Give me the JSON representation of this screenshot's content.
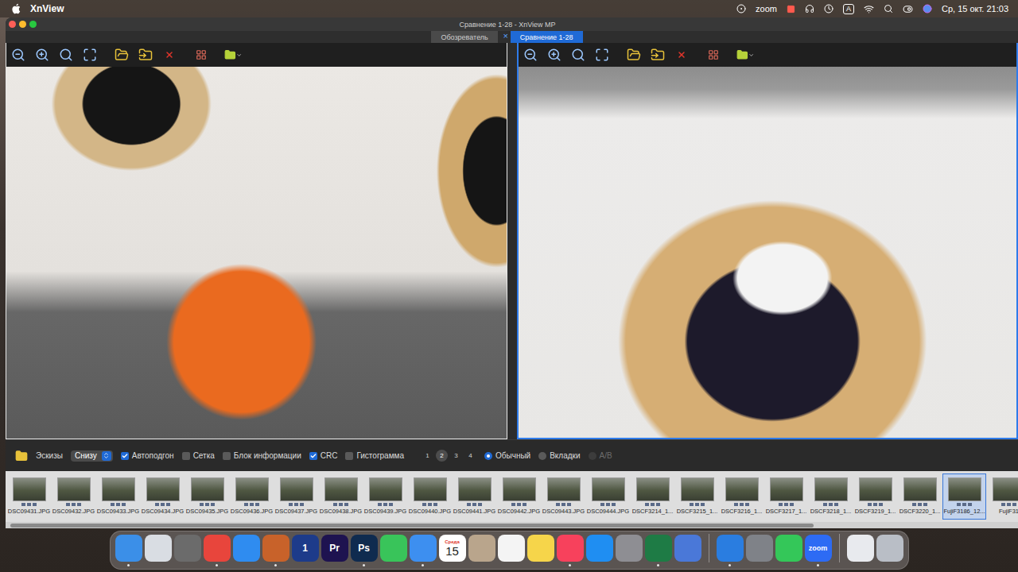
{
  "menubar": {
    "app": "XnView",
    "zoom_label": "zoom",
    "input_source": "A",
    "clock": "Ср, 15 окт. 21:03"
  },
  "window": {
    "title": "Сравнение 1-28 - XnView MP"
  },
  "tabs": [
    {
      "label": "Обозреватель",
      "selected": false
    },
    {
      "label": "Сравнение 1-28",
      "selected": true
    }
  ],
  "tab_close": "×",
  "panes": [
    {
      "focused": false
    },
    {
      "focused": true
    }
  ],
  "options": {
    "thumbs_label": "Эскизы",
    "position": "Снизу",
    "checkboxes": [
      {
        "label": "Автоподгон",
        "checked": true
      },
      {
        "label": "Сетка",
        "checked": false
      },
      {
        "label": "Блок информации",
        "checked": false
      },
      {
        "label": "CRC",
        "checked": true
      },
      {
        "label": "Гистограмма",
        "checked": false
      }
    ],
    "pages": [
      {
        "label": "1",
        "selected": false
      },
      {
        "label": "2",
        "selected": true
      },
      {
        "label": "3",
        "selected": false
      },
      {
        "label": "4",
        "selected": false
      }
    ],
    "modes": [
      {
        "label": "Обычный",
        "selected": true,
        "disabled": false
      },
      {
        "label": "Вкладки",
        "selected": false,
        "disabled": false
      },
      {
        "label": "A/B",
        "selected": false,
        "disabled": true
      }
    ]
  },
  "thumbnails": [
    {
      "label": "DSC09431.JPG",
      "selected": false
    },
    {
      "label": "DSC09432.JPG",
      "selected": false
    },
    {
      "label": "DSC09433.JPG",
      "selected": false
    },
    {
      "label": "DSC09434.JPG",
      "selected": false
    },
    {
      "label": "DSC09435.JPG",
      "selected": false
    },
    {
      "label": "DSC09436.JPG",
      "selected": false
    },
    {
      "label": "DSC09437.JPG",
      "selected": false
    },
    {
      "label": "DSC09438.JPG",
      "selected": false
    },
    {
      "label": "DSC09439.JPG",
      "selected": false
    },
    {
      "label": "DSC09440.JPG",
      "selected": false
    },
    {
      "label": "DSC09441.JPG",
      "selected": false
    },
    {
      "label": "DSC09442.JPG",
      "selected": false
    },
    {
      "label": "DSC09443.JPG",
      "selected": false
    },
    {
      "label": "DSC09444.JPG",
      "selected": false
    },
    {
      "label": "DSCF3214_1...",
      "selected": false
    },
    {
      "label": "DSCF3215_1...",
      "selected": false
    },
    {
      "label": "DSCF3216_1...",
      "selected": false
    },
    {
      "label": "DSCF3217_1...",
      "selected": false
    },
    {
      "label": "DSCF3218_1...",
      "selected": false
    },
    {
      "label": "DSCF3219_1...",
      "selected": false
    },
    {
      "label": "DSCF3220_1...",
      "selected": false
    },
    {
      "label": "FujiF3186_12...",
      "selected": true
    },
    {
      "label": "FujiF31",
      "selected": false
    }
  ],
  "dock": [
    {
      "kind": "app",
      "label": "",
      "color": "#3b8fe8",
      "running": true
    },
    {
      "kind": "app",
      "label": "",
      "color": "#d9dde3",
      "running": false
    },
    {
      "kind": "app",
      "label": "",
      "color": "#6b6b6b",
      "running": false
    },
    {
      "kind": "app",
      "label": "",
      "color": "#e8453c",
      "running": true
    },
    {
      "kind": "app",
      "label": "",
      "color": "#2f8cf0",
      "running": false
    },
    {
      "kind": "app",
      "label": "",
      "color": "#c8622a",
      "running": true
    },
    {
      "kind": "app",
      "label": "1",
      "color": "#1d3b8a",
      "running": false
    },
    {
      "kind": "app",
      "label": "Pr",
      "color": "#1e1350",
      "running": false
    },
    {
      "kind": "app",
      "label": "Ps",
      "color": "#0f2b4f",
      "running": true
    },
    {
      "kind": "app",
      "label": "",
      "color": "#39c45a",
      "running": false
    },
    {
      "kind": "app",
      "label": "",
      "color": "#3d8ff0",
      "running": true
    },
    {
      "kind": "calendar",
      "label": "Среда",
      "day": "15",
      "color": "#ffffff",
      "running": false
    },
    {
      "kind": "app",
      "label": "",
      "color": "#b9a58c",
      "running": false
    },
    {
      "kind": "app",
      "label": "",
      "color": "#f4f4f4",
      "running": false
    },
    {
      "kind": "app",
      "label": "",
      "color": "#f6d54a",
      "running": false
    },
    {
      "kind": "app",
      "label": "",
      "color": "#f7415c",
      "running": true
    },
    {
      "kind": "app",
      "label": "",
      "color": "#1f8ef2",
      "running": false
    },
    {
      "kind": "app",
      "label": "",
      "color": "#8e8e93",
      "running": false
    },
    {
      "kind": "app",
      "label": "",
      "color": "#1e7b45",
      "running": true
    },
    {
      "kind": "app",
      "label": "",
      "color": "#4a78d8",
      "running": false
    },
    {
      "kind": "separator"
    },
    {
      "kind": "app",
      "label": "",
      "color": "#2a7de0",
      "running": true
    },
    {
      "kind": "app",
      "label": "",
      "color": "#7f8288",
      "running": false
    },
    {
      "kind": "app",
      "label": "",
      "color": "#34c759",
      "running": false
    },
    {
      "kind": "app",
      "label": "zoom",
      "color": "#2d6bf4",
      "running": true
    },
    {
      "kind": "separator"
    },
    {
      "kind": "app",
      "label": "",
      "color": "#e8eaee",
      "running": false
    },
    {
      "kind": "app",
      "label": "",
      "color": "#b9bec6",
      "running": false
    }
  ]
}
